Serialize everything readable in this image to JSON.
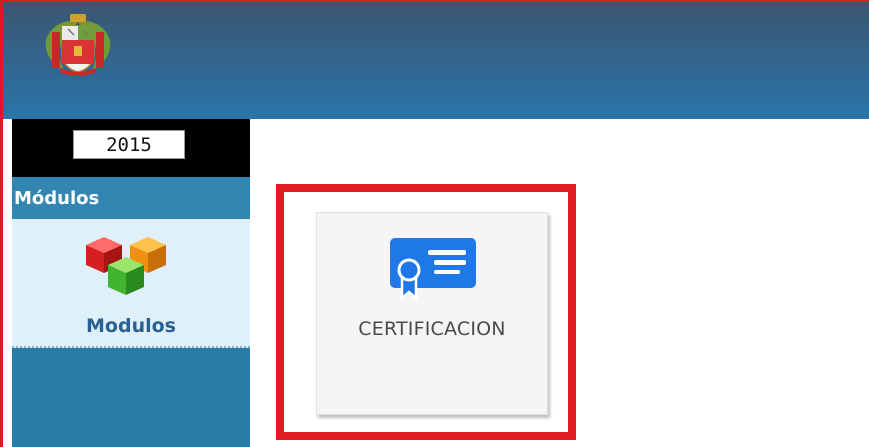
{
  "header": {
    "logo_icon": "peru-coat-of-arms-icon"
  },
  "sidebar": {
    "year_value": "2015",
    "modules_header": "Módulos",
    "module_item_label": "Modulos",
    "module_item_icon": "cubes-icon"
  },
  "main": {
    "tile_label": "CERTIFICACION",
    "tile_icon": "certificate-icon",
    "highlight_color": "#e01b24"
  },
  "colors": {
    "header": "#2f6d98",
    "sidebar": "#2a7ba8",
    "module_item_bg": "#dff0fb",
    "certificate_blue": "#1e78e8"
  }
}
